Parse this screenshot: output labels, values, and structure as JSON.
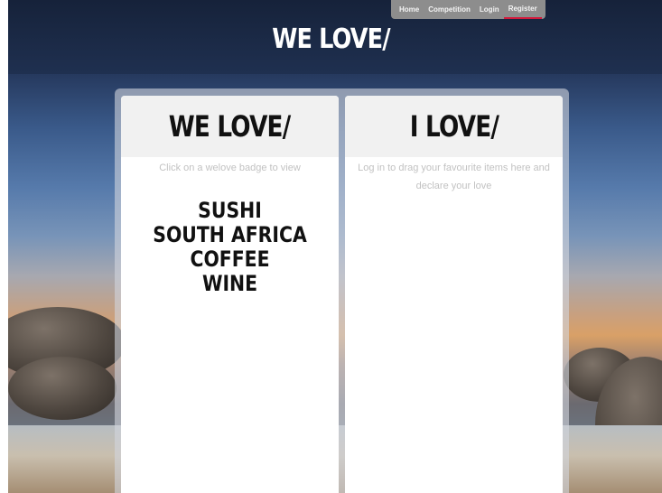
{
  "nav": {
    "items": [
      {
        "label": "Home"
      },
      {
        "label": "Competition"
      },
      {
        "label": "Login"
      },
      {
        "label": "Register"
      }
    ],
    "active_index": 3
  },
  "header": {
    "title": "WE LOVE/"
  },
  "panels": {
    "we_love": {
      "heading": "WE LOVE/",
      "hint": "Click on a welove badge to view",
      "items": [
        {
          "label": "SUSHI"
        },
        {
          "label": "SOUTH AFRICA"
        },
        {
          "label": "COFFEE"
        },
        {
          "label": "WINE"
        }
      ]
    },
    "i_love": {
      "heading": "I LOVE/",
      "hint": "Log in to drag your favourite items here and declare your love"
    }
  },
  "colors": {
    "header_band": "#1f3050",
    "nav_background": "#8d8d8d",
    "nav_active_underline": "#d21a3c",
    "panel_background": "#ffffff",
    "panel_head_background": "#f1f1f1",
    "hint_text": "#c2c2c2"
  }
}
